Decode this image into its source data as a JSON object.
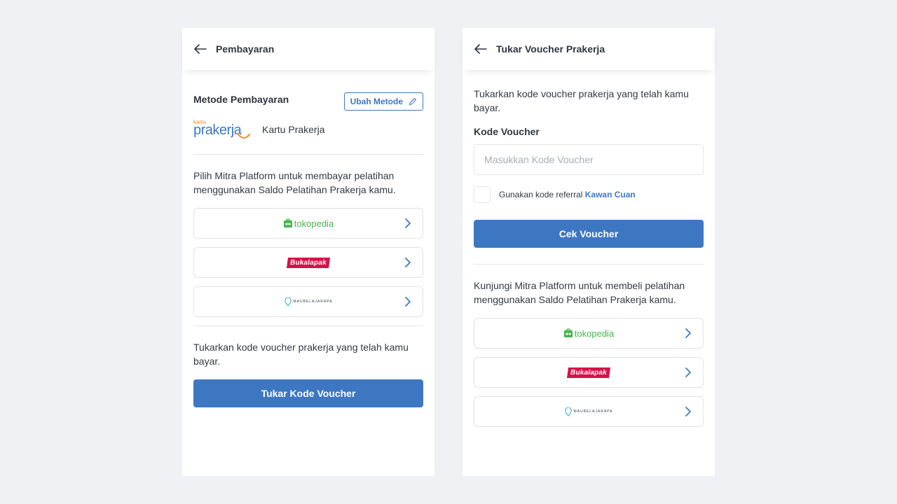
{
  "left": {
    "title": "Pembayaran",
    "method_title": "Metode Pembayaran",
    "ubah_label": "Ubah Metode",
    "prakerja_logo_small": "kartu",
    "prakerja_logo_big": "prakerja",
    "prakerja_label": "Kartu Prakerja",
    "platform_text": "Pilih Mitra Platform untuk membayar pelatihan menggunakan Saldo Pelatihan Prakerja kamu.",
    "partners": [
      {
        "name": "tokopedia"
      },
      {
        "name": "Bukalapak"
      },
      {
        "name": "MAUBELAJARAPA"
      }
    ],
    "voucher_text": "Tukarkan kode voucher prakerja yang telah kamu bayar.",
    "voucher_button": "Tukar Kode Voucher"
  },
  "right": {
    "title": "Tukar Voucher Prakerja",
    "intro_text": "Tukarkan kode voucher prakerja yang telah kamu bayar.",
    "field_label": "Kode Voucher",
    "field_placeholder": "Masukkan Kode Voucher",
    "referral_text": "Gunakan kode referral",
    "referral_link": "Kawan Cuan",
    "check_button": "Cek Voucher",
    "platform_text": "Kunjungi Mitra Platform untuk membeli pelatihan menggunakan Saldo Pelatihan Prakerja kamu.",
    "partners": [
      {
        "name": "tokopedia"
      },
      {
        "name": "Bukalapak"
      },
      {
        "name": "MAUBELAJARAPA"
      }
    ]
  },
  "colors": {
    "primary": "#3d77c2",
    "tokopedia": "#42b549",
    "bukalapak": "#d71149",
    "prakerja_orange": "#f28c2e"
  }
}
